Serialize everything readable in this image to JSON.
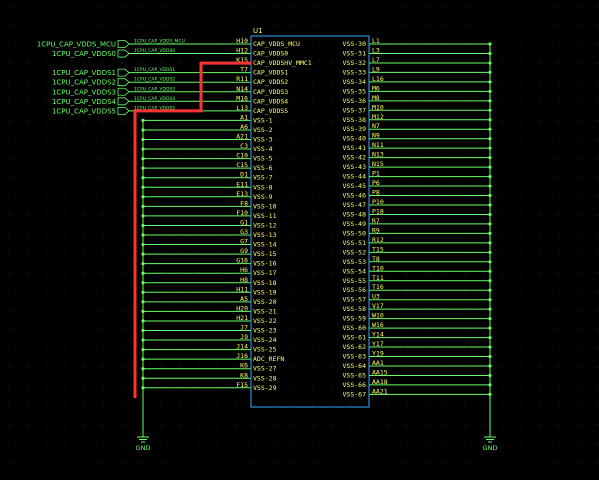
{
  "component": {
    "refdes": "U1",
    "left_pins": [
      {
        "num": "H10",
        "name": "CAP_VDDS_MCU"
      },
      {
        "num": "H12",
        "name": "CAP_VDDS0"
      },
      {
        "num": "K15",
        "name": "CAP_VDDSHV_MMC1"
      },
      {
        "num": "T7",
        "name": "CAP_VDDS1"
      },
      {
        "num": "R11",
        "name": "CAP_VDDS2"
      },
      {
        "num": "N14",
        "name": "CAP_VDDS3"
      },
      {
        "num": "M16",
        "name": "CAP_VDDS4"
      },
      {
        "num": "L13",
        "name": "CAP_VDDS5"
      },
      {
        "num": "A1",
        "name": "VSS-1"
      },
      {
        "num": "A6",
        "name": "VSS-2"
      },
      {
        "num": "A21",
        "name": "VSS-3"
      },
      {
        "num": "C3",
        "name": "VSS-4"
      },
      {
        "num": "C10",
        "name": "VSS-5"
      },
      {
        "num": "C15",
        "name": "VSS-6"
      },
      {
        "num": "D1",
        "name": "VSS-7"
      },
      {
        "num": "E11",
        "name": "VSS-8"
      },
      {
        "num": "E13",
        "name": "VSS-9"
      },
      {
        "num": "F8",
        "name": "VSS-10"
      },
      {
        "num": "F10",
        "name": "VSS-11"
      },
      {
        "num": "G1",
        "name": "VSS-12"
      },
      {
        "num": "G3",
        "name": "VSS-13"
      },
      {
        "num": "G7",
        "name": "VSS-14"
      },
      {
        "num": "G9",
        "name": "VSS-15"
      },
      {
        "num": "G16",
        "name": "VSS-16"
      },
      {
        "num": "H6",
        "name": "VSS-17"
      },
      {
        "num": "H8",
        "name": "VSS-18"
      },
      {
        "num": "H11",
        "name": "VSS-19"
      },
      {
        "num": "A5",
        "name": "VSS-20"
      },
      {
        "num": "H20",
        "name": "VSS-21"
      },
      {
        "num": "H21",
        "name": "VSS-22"
      },
      {
        "num": "J7",
        "name": "VSS-23"
      },
      {
        "num": "J9",
        "name": "VSS-24"
      },
      {
        "num": "J14",
        "name": "VSS-25"
      },
      {
        "num": "J16",
        "name": "ADC_REFN"
      },
      {
        "num": "K6",
        "name": "VSS-27"
      },
      {
        "num": "K8",
        "name": "VSS-28"
      },
      {
        "num": "F15",
        "name": "VSS-29"
      }
    ],
    "right_pins": [
      {
        "num": "L1",
        "name": "VSS-30"
      },
      {
        "num": "L3",
        "name": "VSS-31"
      },
      {
        "num": "L7",
        "name": "VSS-32"
      },
      {
        "num": "L9",
        "name": "VSS-33"
      },
      {
        "num": "L16",
        "name": "VSS-34"
      },
      {
        "num": "M6",
        "name": "VSS-35"
      },
      {
        "num": "M8",
        "name": "VSS-36"
      },
      {
        "num": "M10",
        "name": "VSS-37"
      },
      {
        "num": "M12",
        "name": "VSS-38"
      },
      {
        "num": "N7",
        "name": "VSS-39"
      },
      {
        "num": "N9",
        "name": "VSS-40"
      },
      {
        "num": "N11",
        "name": "VSS-41"
      },
      {
        "num": "N13",
        "name": "VSS-42"
      },
      {
        "num": "N15",
        "name": "VSS-43"
      },
      {
        "num": "P1",
        "name": "VSS-44"
      },
      {
        "num": "P6",
        "name": "VSS-45"
      },
      {
        "num": "P8",
        "name": "VSS-46"
      },
      {
        "num": "P10",
        "name": "VSS-47"
      },
      {
        "num": "P18",
        "name": "VSS-48"
      },
      {
        "num": "R7",
        "name": "VSS-49"
      },
      {
        "num": "R9",
        "name": "VSS-50"
      },
      {
        "num": "R12",
        "name": "VSS-51"
      },
      {
        "num": "T15",
        "name": "VSS-52"
      },
      {
        "num": "T8",
        "name": "VSS-53"
      },
      {
        "num": "T10",
        "name": "VSS-54"
      },
      {
        "num": "T11",
        "name": "VSS-55"
      },
      {
        "num": "T16",
        "name": "VSS-56"
      },
      {
        "num": "U3",
        "name": "VSS-57"
      },
      {
        "num": "V17",
        "name": "VSS-58"
      },
      {
        "num": "W10",
        "name": "VSS-59"
      },
      {
        "num": "W16",
        "name": "VSS-60"
      },
      {
        "num": "Y14",
        "name": "VSS-61"
      },
      {
        "num": "Y17",
        "name": "VSS-62"
      },
      {
        "num": "Y19",
        "name": "VSS-63"
      },
      {
        "num": "AA1",
        "name": "VSS-64"
      },
      {
        "num": "AA15",
        "name": "VSS-65"
      },
      {
        "num": "AA18",
        "name": "VSS-66"
      },
      {
        "num": "AA21",
        "name": "VSS-67"
      }
    ]
  },
  "offpage": [
    {
      "label": "1CPU_CAP_VDDS_MCU",
      "wire": "1CPU_CAP_VDDS_MCU"
    },
    {
      "label": "1CPU_CAP_VDDS0",
      "wire": "1CPU_CAP_VDDS0"
    },
    {
      "label": "1CPU_CAP_VDDS1",
      "wire": "1CPU_CAP_VDDS1"
    },
    {
      "label": "1CPU_CAP_VDDS2",
      "wire": "1CPU_CAP_VDDS2"
    },
    {
      "label": "1CPU_CAP_VDDS3",
      "wire": "1CPU_CAP_VDDS3"
    },
    {
      "label": "1CPU_CAP_VDDS4",
      "wire": "1CPU_CAP_VDDS4"
    },
    {
      "label": "1CPU_CAP_VDDS5",
      "wire": "1CPU_CAP_VDDS5"
    }
  ],
  "ground": {
    "left": "GND",
    "right": "GND"
  },
  "colors": {
    "background": "#000000",
    "wire": "#66ff66",
    "junction": "#66ff66",
    "body": "#33aaff",
    "text": "#ffff66",
    "highlight": "#ff3333"
  }
}
